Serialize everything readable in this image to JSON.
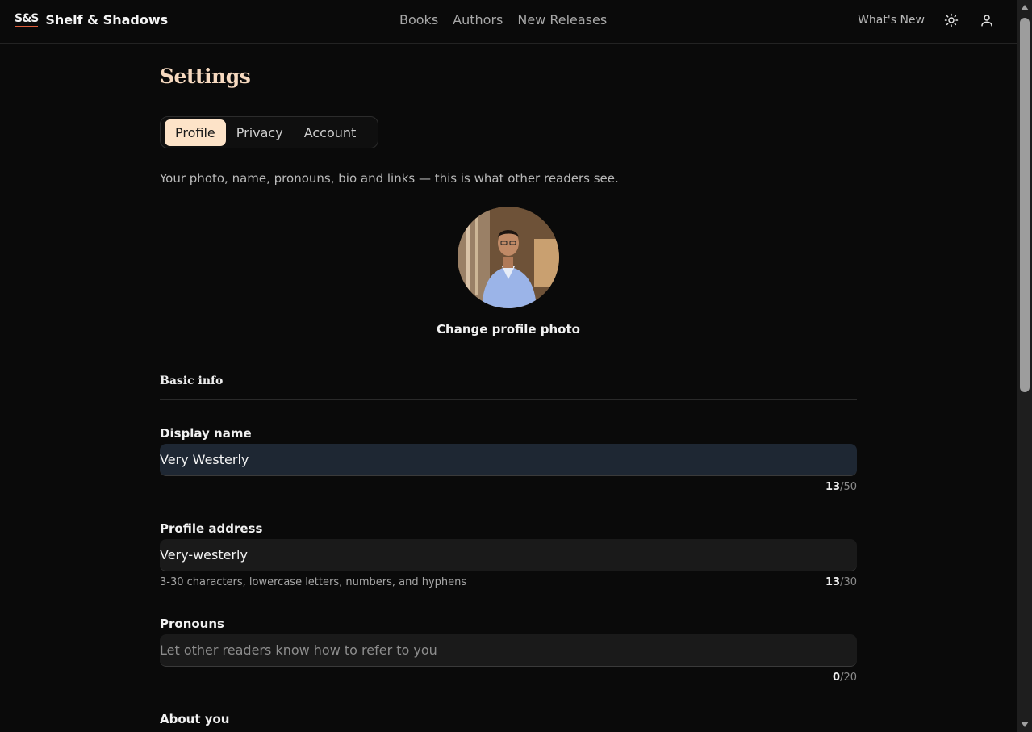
{
  "header": {
    "logo": "S&S",
    "brand": "Shelf & Shadows",
    "nav": [
      "Books",
      "Authors",
      "New Releases"
    ],
    "whats_new": "What's New"
  },
  "settings": {
    "title": "Settings",
    "tabs": [
      {
        "label": "Profile",
        "active": true
      },
      {
        "label": "Privacy",
        "active": false
      },
      {
        "label": "Account",
        "active": false
      }
    ],
    "description": "Your photo, name, pronouns, bio and links — this is what other readers see.",
    "change_photo": "Change profile photo",
    "section_basic": "Basic info",
    "display_name": {
      "label": "Display name",
      "value": "Very Westerly",
      "count": "13",
      "max": "/50"
    },
    "profile_address": {
      "label": "Profile address",
      "value": "Very-westerly",
      "hint": "3-30 characters, lowercase letters, numbers, and hyphens",
      "count": "13",
      "max": "/30"
    },
    "pronouns": {
      "label": "Pronouns",
      "placeholder": "Let other readers know how to refer to you",
      "count": "0",
      "max": "/20"
    },
    "about": {
      "label": "About you"
    }
  },
  "colors": {
    "accent": "#fde3c8",
    "title": "#f6d9bf",
    "logo_underline": "#e0603e"
  }
}
